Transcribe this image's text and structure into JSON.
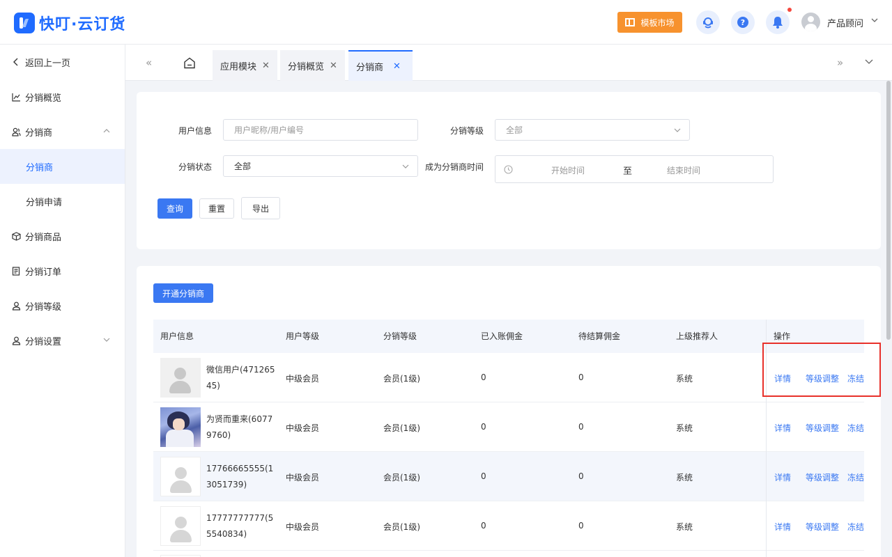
{
  "header": {
    "logo_text": "快叮·云订货",
    "template_market": "模板市场",
    "user_name": "产品顾问",
    "icons": [
      "service-icon",
      "help-icon",
      "bell-icon"
    ]
  },
  "sidebar": {
    "back": "返回上一页",
    "overview": "分销概览",
    "distributor_group": "分销商",
    "distributor": "分销商",
    "distributor_apply": "分销申请",
    "products": "分销商品",
    "orders": "分销订单",
    "levels": "分销等级",
    "settings": "分销设置"
  },
  "tabs": [
    {
      "label": "应用模块"
    },
    {
      "label": "分销概览"
    },
    {
      "label": "分销商"
    }
  ],
  "filters": {
    "user_info_label": "用户信息",
    "user_info_placeholder": "用户昵称/用户编号",
    "level_label": "分销等级",
    "level_value": "全部",
    "status_label": "分销状态",
    "status_value": "全部",
    "time_label": "成为分销商时间",
    "start_placeholder": "开始时间",
    "range_sep": "至",
    "end_placeholder": "结束时间",
    "query": "查询",
    "reset": "重置",
    "export": "导出"
  },
  "table": {
    "open_button": "开通分销商",
    "columns": [
      "用户信息",
      "用户等级",
      "分销等级",
      "已入账佣金",
      "待结算佣金",
      "上级推荐人",
      "操作"
    ],
    "actions": {
      "detail": "详情",
      "adjust": "等级调整",
      "freeze": "冻结"
    },
    "rows": [
      {
        "name": "微信用户(47126545)",
        "user_level": "中级会员",
        "dist_level": "会员(1级)",
        "settled": "0",
        "pending": "0",
        "referrer": "系统"
      },
      {
        "name": "为贤而重来(60779760)",
        "user_level": "中级会员",
        "dist_level": "会员(1级)",
        "settled": "0",
        "pending": "0",
        "referrer": "系统"
      },
      {
        "name": "17766665555(13051739)",
        "user_level": "中级会员",
        "dist_level": "会员(1级)",
        "settled": "0",
        "pending": "0",
        "referrer": "系统"
      },
      {
        "name": "17777777777(55540834)",
        "user_level": "中级会员",
        "dist_level": "会员(1级)",
        "settled": "0",
        "pending": "0",
        "referrer": "系统"
      }
    ]
  }
}
